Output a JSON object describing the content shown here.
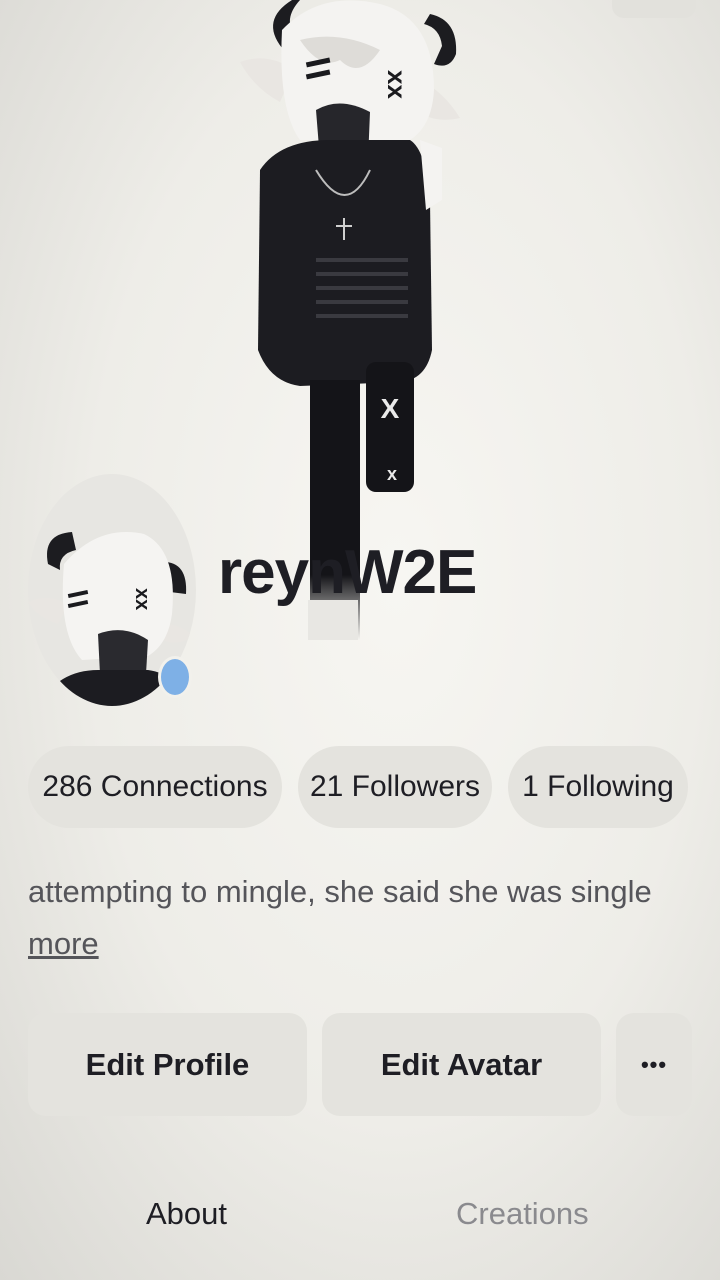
{
  "profile": {
    "username": "reynW2E",
    "bio": "attempting to mingle, she said she was single",
    "more_label": "more",
    "status_color": "#7eb0e6"
  },
  "stats": {
    "connections": "286 Connections",
    "followers": "21 Followers",
    "following": "1 Following"
  },
  "actions": {
    "edit_profile": "Edit Profile",
    "edit_avatar": "Edit Avatar",
    "more_options": "•••"
  },
  "tabs": {
    "about": "About",
    "creations": "Creations",
    "active_tab": "About"
  }
}
